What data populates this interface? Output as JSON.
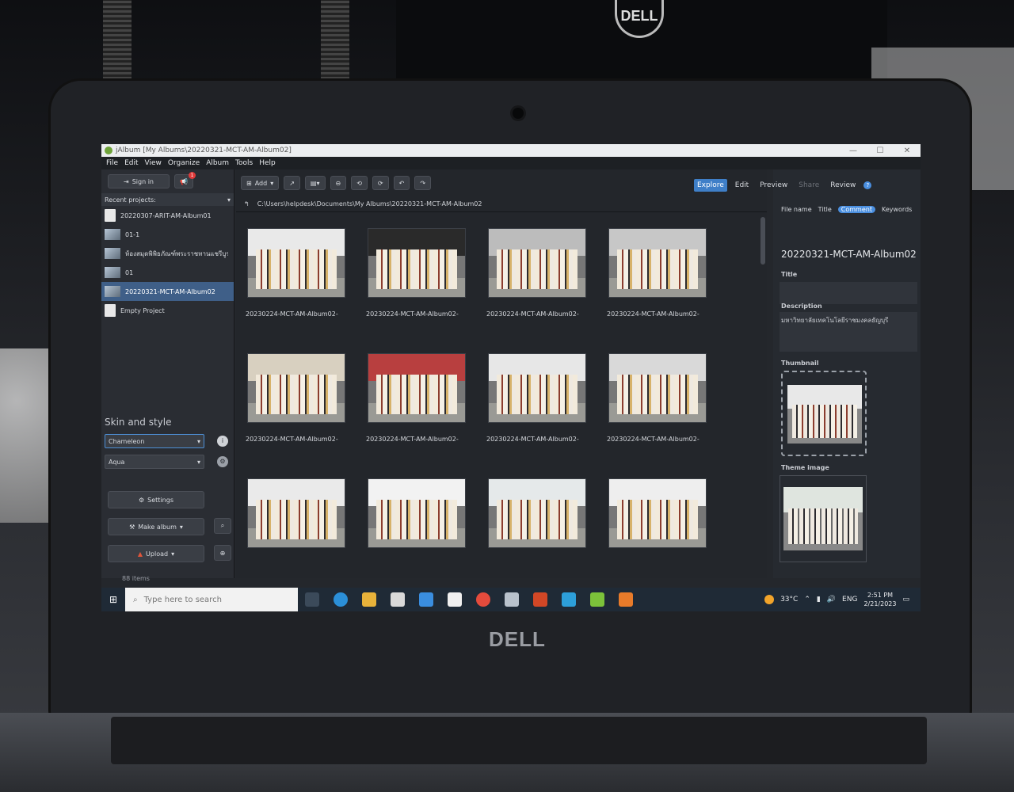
{
  "window": {
    "title": "jAlbum [My Albums\\20220321-MCT-AM-Album02]"
  },
  "menu": [
    "File",
    "Edit",
    "View",
    "Organize",
    "Album",
    "Tools",
    "Help"
  ],
  "left": {
    "sign_in": "Sign in",
    "notif_count": "1",
    "recent_label": "Recent projects:",
    "projects": [
      {
        "label": "20220307-ARIT-AM-Album01"
      },
      {
        "label": "01-1"
      },
      {
        "label": "ห้องสมุดพิพิธภัณฑ์พระราชทานแชรีบูรณ์"
      },
      {
        "label": "01"
      },
      {
        "label": "20220321-MCT-AM-Album02"
      },
      {
        "label": "Empty Project"
      }
    ],
    "skin_title": "Skin and style",
    "skin": "Chameleon",
    "style": "Aqua",
    "settings": "Settings",
    "make_album": "Make album",
    "upload": "Upload",
    "items_count": "88 items"
  },
  "toolbar": {
    "add": "Add"
  },
  "path": "C:\\Users\\helpdesk\\Documents\\My Albums\\20220321-MCT-AM-Album02",
  "tabs": [
    "Explore",
    "Edit",
    "Preview",
    "Share",
    "Review"
  ],
  "subtabs": [
    "File name",
    "Title",
    "Comment",
    "Keywords"
  ],
  "thumbnails": [
    {
      "caption": "20230224-MCT-AM-Album02-",
      "sky": "#e9e9e9"
    },
    {
      "caption": "20230224-MCT-AM-Album02-",
      "sky": "#2a2a2a"
    },
    {
      "caption": "20230224-MCT-AM-Album02-",
      "sky": "#bcbcbc"
    },
    {
      "caption": "20230224-MCT-AM-Album02-",
      "sky": "#c7c7c7"
    },
    {
      "caption": "20230224-MCT-AM-Album02-",
      "sky": "#d8d0c0"
    },
    {
      "caption": "20230224-MCT-AM-Album02-",
      "sky": "#b83f3f"
    },
    {
      "caption": "20230224-MCT-AM-Album02-",
      "sky": "#e7e7e7"
    },
    {
      "caption": "20230224-MCT-AM-Album02-",
      "sky": "#d9d9d9"
    },
    {
      "caption": "",
      "sky": "#eaeaea"
    },
    {
      "caption": "",
      "sky": "#f2f2f2"
    },
    {
      "caption": "",
      "sky": "#e5e9ea"
    },
    {
      "caption": "",
      "sky": "#eeeeee"
    }
  ],
  "right": {
    "album_title": "20220321-MCT-AM-Album02",
    "title_label": "Title",
    "desc_label": "Description",
    "desc_text": "มหาวิทยาลัยเทคโนโลยีราชมงคลธัญบุรี",
    "thumb_label": "Thumbnail",
    "theme_label": "Theme image"
  },
  "taskbar": {
    "search_placeholder": "Type here to search",
    "temp": "33°C",
    "lang": "ENG",
    "time": "2:51 PM",
    "date": "2/21/2023"
  },
  "background": {
    "brand": "DELL"
  }
}
